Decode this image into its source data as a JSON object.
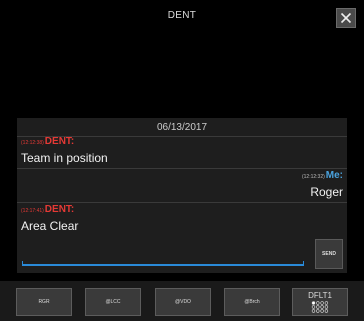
{
  "header": {
    "title": "DENT"
  },
  "chat": {
    "date": "06/13/2017",
    "messages": [
      {
        "time": "(12:12:38)",
        "sender": "DENT:",
        "text": "Team in position",
        "from_me": false
      },
      {
        "time": "(12:12:32)",
        "sender": "Me:",
        "text": "Roger",
        "from_me": true
      },
      {
        "time": "(12:17:41)",
        "sender": "DENT:",
        "text": "Area Clear",
        "from_me": false
      }
    ]
  },
  "composer": {
    "input_value": "",
    "send_label": "SEND"
  },
  "quick_buttons": [
    "RGR",
    "@LCC",
    "@VDO",
    "@Brch"
  ],
  "preset": {
    "label": "DFLT1",
    "icon": "dot-grid-icon"
  },
  "colors": {
    "background": "#000000",
    "chat_background": "#1e1e1e",
    "sender_other": "#e53935",
    "sender_me": "#4aa3df",
    "input_underline": "#2a8ad8"
  }
}
